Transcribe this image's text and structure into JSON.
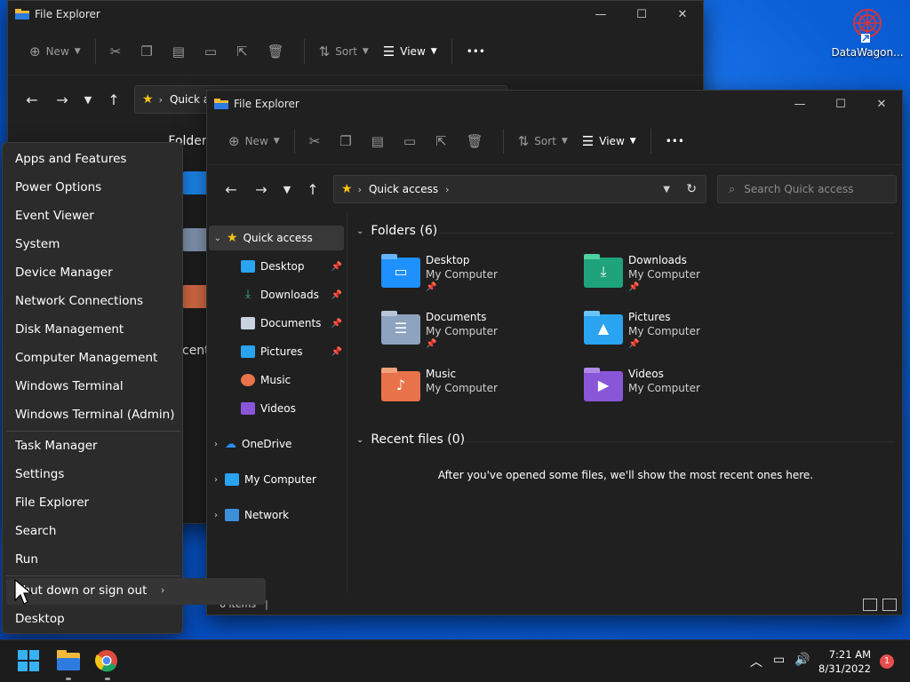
{
  "desktop": {
    "icon_label": "DataWagon..."
  },
  "back_window": {
    "title": "File Explorer",
    "toolbar": {
      "new_label": "New",
      "sort_label": "Sort",
      "view_label": "View"
    },
    "address_text": "Quick a",
    "folders_header_partial": "Folder",
    "recent_partial": "cent"
  },
  "front_window": {
    "title": "File Explorer",
    "toolbar": {
      "new_label": "New",
      "sort_label": "Sort",
      "view_label": "View",
      "more_label": "•••"
    },
    "address": {
      "location": "Quick access"
    },
    "search": {
      "placeholder": "Search Quick access"
    },
    "nav": {
      "quick_access": "Quick access",
      "items": [
        {
          "label": "Desktop",
          "icon": "desktop-icon",
          "pinned": true
        },
        {
          "label": "Downloads",
          "icon": "downloads-icon",
          "pinned": true
        },
        {
          "label": "Documents",
          "icon": "documents-icon",
          "pinned": true
        },
        {
          "label": "Pictures",
          "icon": "pictures-icon",
          "pinned": true
        },
        {
          "label": "Music",
          "icon": "music-icon",
          "pinned": false
        },
        {
          "label": "Videos",
          "icon": "videos-icon",
          "pinned": false
        }
      ],
      "onedrive": "OneDrive",
      "my_computer": "My Computer",
      "network": "Network"
    },
    "folders": {
      "header": "Folders (6)",
      "items": [
        {
          "name": "Desktop",
          "location": "My Computer",
          "pinned": true,
          "color": "#1e90ff"
        },
        {
          "name": "Downloads",
          "location": "My Computer",
          "pinned": true,
          "color": "#1fa37a"
        },
        {
          "name": "Documents",
          "location": "My Computer",
          "pinned": true,
          "color": "#8da3bf"
        },
        {
          "name": "Pictures",
          "location": "My Computer",
          "pinned": true,
          "color": "#2aa3f0"
        },
        {
          "name": "Music",
          "location": "My Computer",
          "pinned": false,
          "color": "#e8734a"
        },
        {
          "name": "Videos",
          "location": "My Computer",
          "pinned": false,
          "color": "#8a56d8"
        }
      ]
    },
    "recent": {
      "header": "Recent files (0)",
      "empty_message": "After you've opened some files, we'll show the most recent ones here."
    },
    "status": {
      "items_count": "6 items"
    }
  },
  "context_menu": {
    "group1": [
      "Apps and Features",
      "Power Options",
      "Event Viewer",
      "System",
      "Device Manager",
      "Network Connections",
      "Disk Management",
      "Computer Management",
      "Windows Terminal",
      "Windows Terminal (Admin)"
    ],
    "group2": [
      "Task Manager",
      "Settings",
      "File Explorer",
      "Search",
      "Run"
    ],
    "shutdown": "Shut down or sign out",
    "desktop": "Desktop"
  },
  "taskbar": {
    "time": "7:21 AM",
    "date": "8/31/2022",
    "notification_count": "1"
  }
}
